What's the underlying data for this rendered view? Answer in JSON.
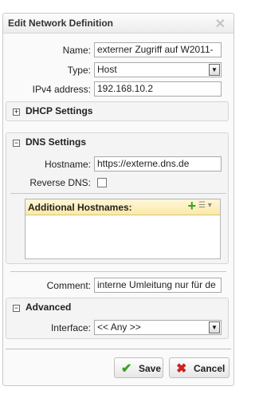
{
  "dialog": {
    "title": "Edit Network Definition",
    "close_glyph": "✕"
  },
  "form": {
    "name_label": "Name:",
    "name_value": "externer Zugriff auf W2011-",
    "type_label": "Type:",
    "type_value": "Host",
    "ipv4_label": "IPv4 address:",
    "ipv4_value": "192.168.10.2"
  },
  "dhcp": {
    "label": "DHCP Settings",
    "toggle": "+"
  },
  "dns": {
    "label": "DNS Settings",
    "toggle": "−",
    "hostname_label": "Hostname:",
    "hostname_value": "https://externe.dns.de",
    "reverse_label": "Reverse DNS:",
    "reverse_checked": false,
    "hosts_title": "Additional Hostnames:",
    "hosts_add_glyph": "+",
    "hosts_menu_glyph": "☰ ▾"
  },
  "comment": {
    "label": "Comment:",
    "value": "interne Umleitung nur für de"
  },
  "advanced": {
    "label": "Advanced",
    "toggle": "−",
    "interface_label": "Interface:",
    "interface_value": "<< Any >>"
  },
  "buttons": {
    "save_label": "Save",
    "save_icon": "✔",
    "cancel_label": "Cancel",
    "cancel_icon": "✖"
  },
  "colors": {
    "accent_green": "#3aa124",
    "cancel_red": "#cc2222",
    "hosts_header": "#fbe9a8"
  },
  "icons": {
    "select_arrow": "▼"
  }
}
